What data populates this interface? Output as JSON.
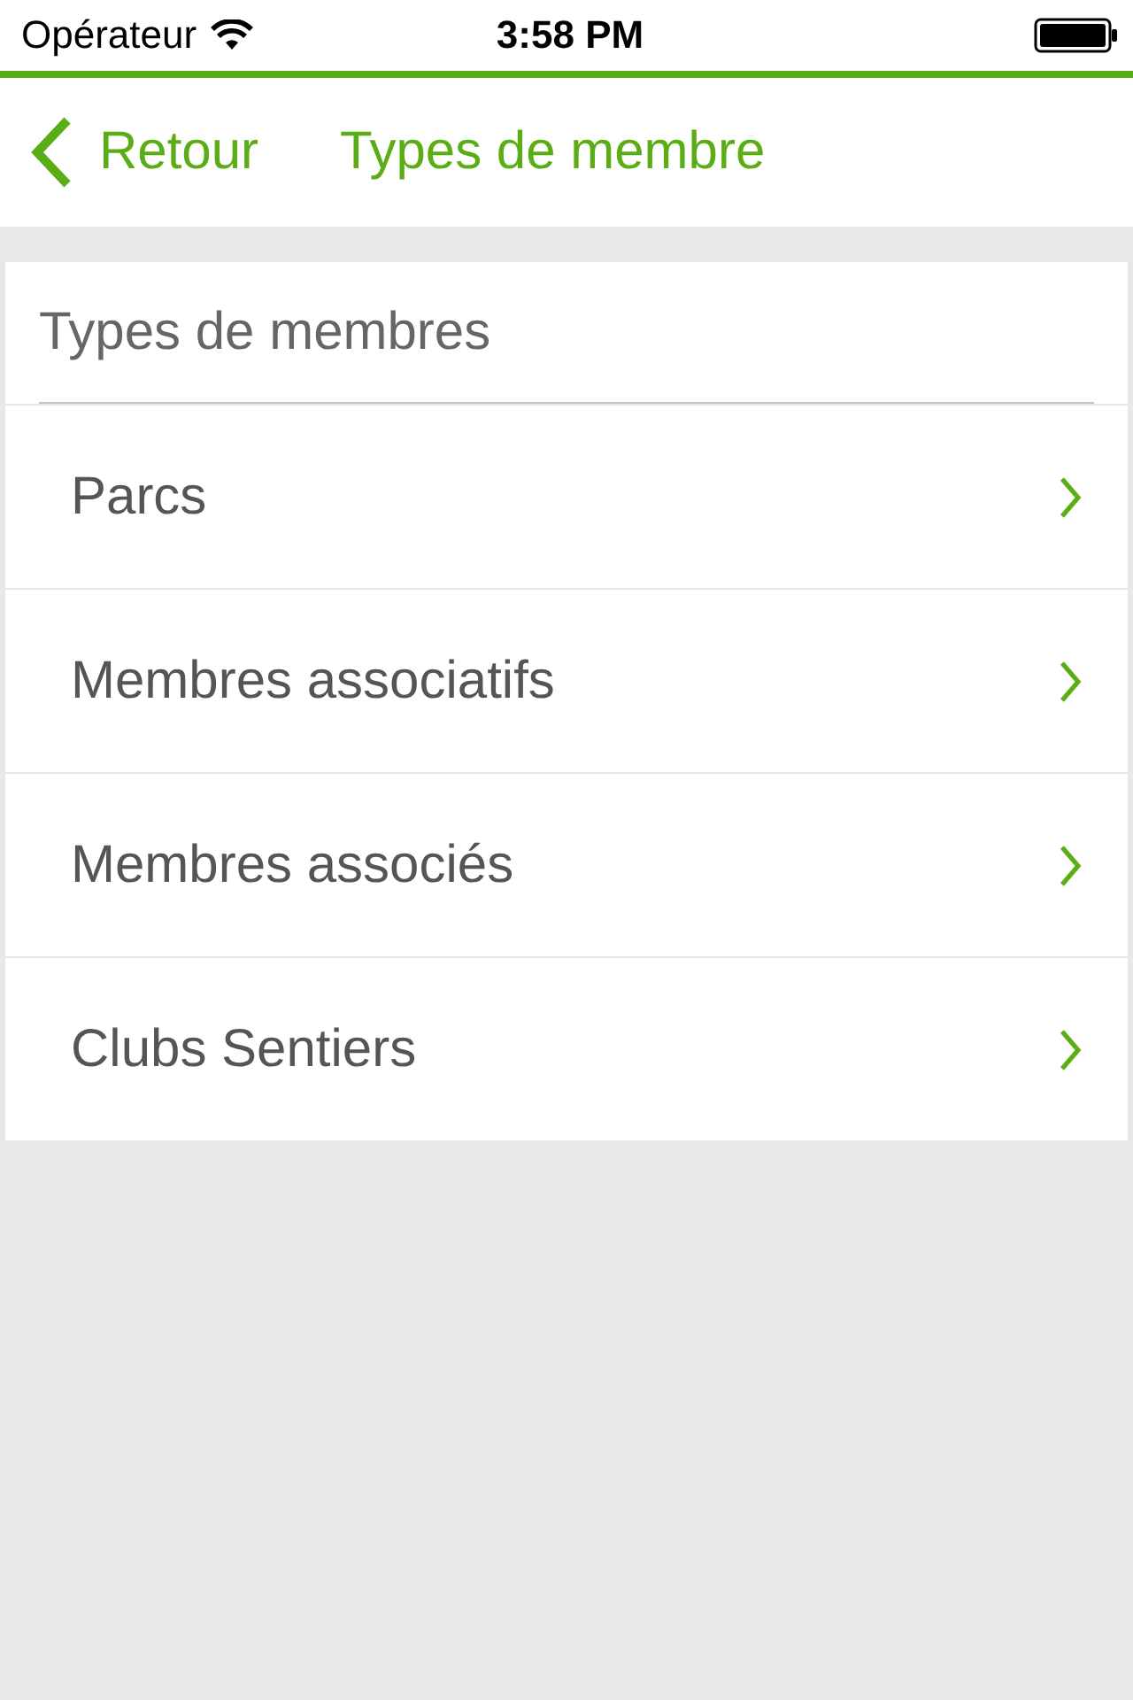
{
  "status_bar": {
    "carrier": "Opérateur",
    "time": "3:58 PM"
  },
  "nav_bar": {
    "back_label": "Retour",
    "title": "Types de membre"
  },
  "list": {
    "header": "Types de membres",
    "items": [
      {
        "label": "Parcs"
      },
      {
        "label": "Membres associatifs"
      },
      {
        "label": "Membres associés"
      },
      {
        "label": "Clubs Sentiers"
      }
    ]
  }
}
